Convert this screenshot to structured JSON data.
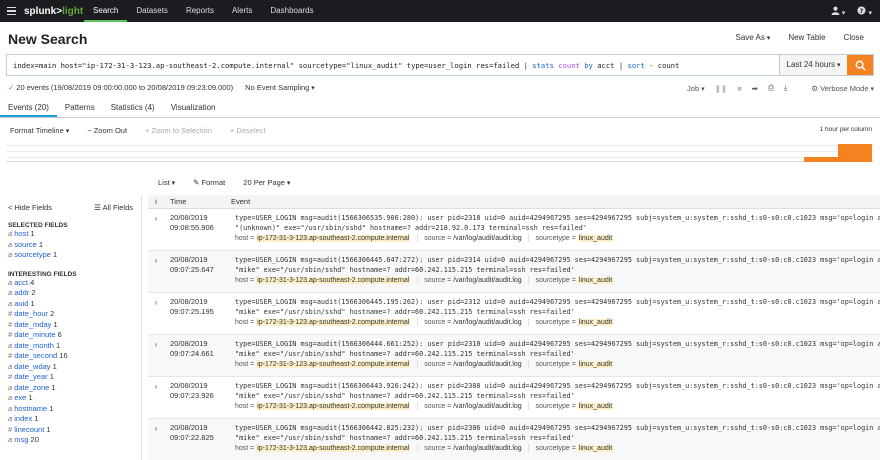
{
  "nav": {
    "logo_main": "splunk>",
    "logo_sub": "light",
    "items": [
      "Search",
      "Datasets",
      "Reports",
      "Alerts",
      "Dashboards"
    ],
    "user_icon": "user-icon",
    "help_icon": "help-icon"
  },
  "title": "New Search",
  "title_actions": [
    "Save As",
    "New Table",
    "Close"
  ],
  "search": {
    "query_parts": [
      {
        "t": "index=main host=\"ip-172-31-3-123.ap-southeast-2.compute.internal\" sourcetype=\"linux_audit\" type=user_login res=failed ",
        "c": "txt"
      },
      {
        "t": "| ",
        "c": "pipe"
      },
      {
        "t": "stats ",
        "c": "cmd"
      },
      {
        "t": "count ",
        "c": "fn"
      },
      {
        "t": "by ",
        "c": "cmd"
      },
      {
        "t": "acct ",
        "c": "txt"
      },
      {
        "t": "| ",
        "c": "pipe"
      },
      {
        "t": "sort ",
        "c": "cmd"
      },
      {
        "t": "- count",
        "c": "txt"
      }
    ],
    "time_range": "Last 24 hours",
    "button_icon": "search-icon"
  },
  "status": {
    "events": "20 events (19/08/2019 09:00:00.000 to 20/08/2019 09:23:09.000)",
    "sampling": "No Event Sampling",
    "job": "Job",
    "mode": "Verbose Mode"
  },
  "tabs": [
    "Events (20)",
    "Patterns",
    "Statistics (4)",
    "Visualization"
  ],
  "timeline_toolbar": {
    "format": "Format Timeline",
    "zoom_out": "− Zoom Out",
    "zoom_sel": "+ Zoom to Selection",
    "deselect": "× Deselect",
    "scale": "1 hour per column"
  },
  "timeline_bars": [
    {
      "label": "",
      "fraction": 0.25
    },
    {
      "label": "",
      "fraction": 1.0
    }
  ],
  "results_toolbar": {
    "list": "List",
    "format": "Format",
    "per_page": "20 Per Page"
  },
  "sidebar": {
    "hide": "< Hide Fields",
    "all": "All Fields",
    "selected_title": "SELECTED FIELDS",
    "selected": [
      {
        "type": "a",
        "name": "host",
        "count": "1"
      },
      {
        "type": "a",
        "name": "source",
        "count": "1"
      },
      {
        "type": "a",
        "name": "sourcetype",
        "count": "1"
      }
    ],
    "interesting_title": "INTERESTING FIELDS",
    "interesting": [
      {
        "type": "a",
        "name": "acct",
        "count": "4"
      },
      {
        "type": "a",
        "name": "addr",
        "count": "2"
      },
      {
        "type": "a",
        "name": "auid",
        "count": "1"
      },
      {
        "type": "#",
        "name": "date_hour",
        "count": "2"
      },
      {
        "type": "#",
        "name": "date_mday",
        "count": "1"
      },
      {
        "type": "#",
        "name": "date_minute",
        "count": "6"
      },
      {
        "type": "a",
        "name": "date_month",
        "count": "1"
      },
      {
        "type": "#",
        "name": "date_second",
        "count": "16"
      },
      {
        "type": "a",
        "name": "date_wday",
        "count": "1"
      },
      {
        "type": "#",
        "name": "date_year",
        "count": "1"
      },
      {
        "type": "a",
        "name": "date_zone",
        "count": "1"
      },
      {
        "type": "a",
        "name": "exe",
        "count": "1"
      },
      {
        "type": "a",
        "name": "hostname",
        "count": "1"
      },
      {
        "type": "a",
        "name": "index",
        "count": "1"
      },
      {
        "type": "#",
        "name": "linecount",
        "count": "1"
      },
      {
        "type": "a",
        "name": "msg",
        "count": "20"
      }
    ]
  },
  "events": {
    "col_info": "i",
    "col_time": "Time",
    "col_event": "Event",
    "host_label": "host =",
    "source_label": "source =",
    "sourcetype_label": "sourcetype =",
    "host_value": "ip-172-31-3-123.ap-southeast-2.compute.internal",
    "source_value": "/var/log/audit/audit.log",
    "sourcetype_value": "linux_audit",
    "rows": [
      {
        "date": "20/08/2019",
        "time": "09:08:55.906",
        "line1": "type=USER_LOGIN msg=audit(1566306535.906:280): user pid=2318 uid=0 auid=4294967295 ses=4294967295 subj=system_u:system_r:sshd_t:s0-s0:c0.c1023 msg='op=login acct=",
        "line2": "\"(unknown)\" exe=\"/usr/sbin/sshd\" hostname=? addr=218.92.0.173 terminal=ssh res=failed'"
      },
      {
        "date": "20/08/2019",
        "time": "09:07:25.647",
        "line1": "type=USER_LOGIN msg=audit(1566306445.647:272): user pid=2314 uid=0 auid=4294967295 ses=4294967295 subj=system_u:system_r:sshd_t:s0-s0:c0.c1023 msg='op=login acct=",
        "line2": "\"mike\" exe=\"/usr/sbin/sshd\" hostname=? addr=60.242.115.215 terminal=ssh res=failed'"
      },
      {
        "date": "20/08/2019",
        "time": "09:07:25.195",
        "line1": "type=USER_LOGIN msg=audit(1566306445.195:262): user pid=2312 uid=0 auid=4294967295 ses=4294967295 subj=system_u:system_r:sshd_t:s0-s0:c0.c1023 msg='op=login acct=",
        "line2": "\"mike\" exe=\"/usr/sbin/sshd\" hostname=? addr=60.242.115.215 terminal=ssh res=failed'"
      },
      {
        "date": "20/08/2019",
        "time": "09:07:24.661",
        "line1": "type=USER_LOGIN msg=audit(1566306444.661:252): user pid=2310 uid=0 auid=4294967295 ses=4294967295 subj=system_u:system_r:sshd_t:s0-s0:c0.c1023 msg='op=login acct=",
        "line2": "\"mike\" exe=\"/usr/sbin/sshd\" hostname=? addr=60.242.115.215 terminal=ssh res=failed'"
      },
      {
        "date": "20/08/2019",
        "time": "09:07:23.926",
        "line1": "type=USER_LOGIN msg=audit(1566306443.926:242): user pid=2308 uid=0 auid=4294967295 ses=4294967295 subj=system_u:system_r:sshd_t:s0-s0:c0.c1023 msg='op=login acct=",
        "line2": "\"mike\" exe=\"/usr/sbin/sshd\" hostname=? addr=60.242.115.215 terminal=ssh res=failed'"
      },
      {
        "date": "20/08/2019",
        "time": "09:07:22.825",
        "line1": "type=USER_LOGIN msg=audit(1566306442.825:232): user pid=2306 uid=0 auid=4294967295 ses=4294967295 subj=system_u:system_r:sshd_t:s0-s0:c0.c1023 msg='op=login acct=",
        "line2": "\"mike\" exe=\"/usr/sbin/sshd\" hostname=? addr=60.242.115.215 terminal=ssh res=failed'"
      }
    ]
  }
}
